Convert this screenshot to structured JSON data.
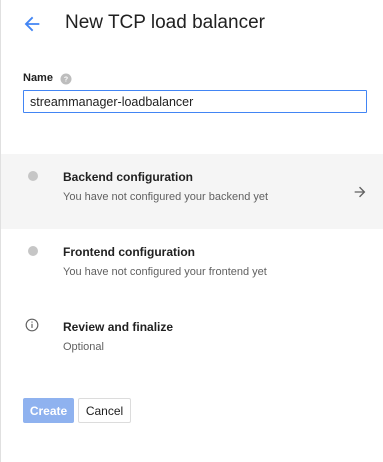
{
  "header": {
    "back_icon": "arrow-back-icon",
    "title": "New TCP load balancer"
  },
  "form": {
    "name_label": "Name",
    "help_icon": "help-circle-icon",
    "name_value": "streammanager-loadbalancer"
  },
  "steps": [
    {
      "title": "Backend configuration",
      "subtitle": "You have not configured your backend yet",
      "status_icon": "dot-icon",
      "action_icon": "arrow-forward-icon",
      "active": true
    },
    {
      "title": "Frontend configuration",
      "subtitle": "You have not configured your frontend yet",
      "status_icon": "dot-icon",
      "active": false
    },
    {
      "title": "Review and finalize",
      "subtitle": "Optional",
      "status_icon": "info-icon",
      "active": false
    }
  ],
  "actions": {
    "create_label": "Create",
    "cancel_label": "Cancel"
  },
  "colors": {
    "accent": "#4285f4",
    "create_disabled_bg": "#8fb2ef",
    "active_step_bg": "#f5f5f5",
    "dot": "#c6c6c6"
  }
}
